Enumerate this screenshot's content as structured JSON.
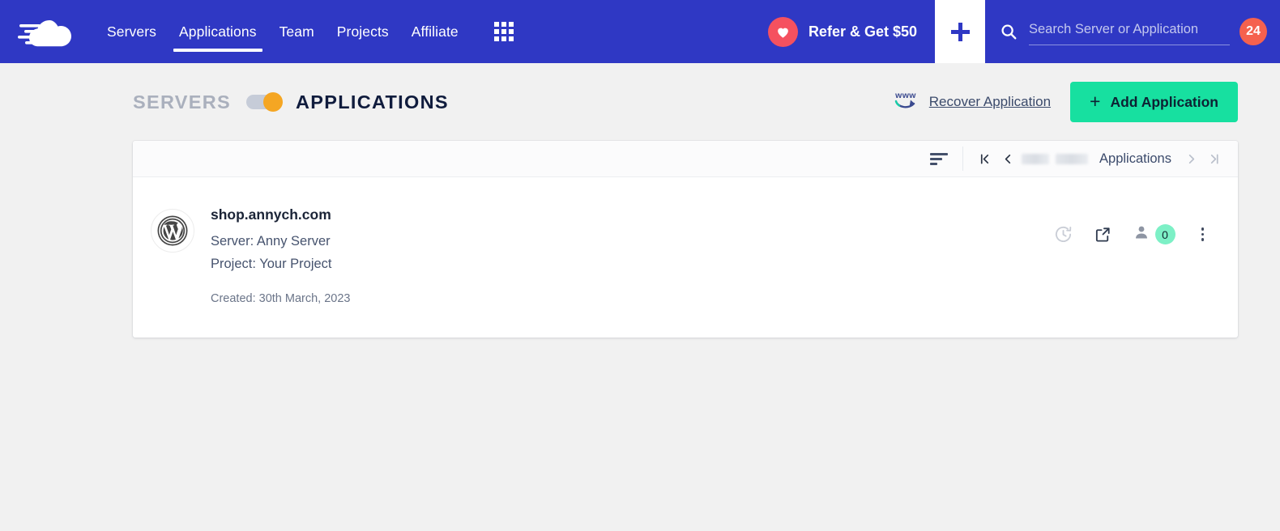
{
  "navbar": {
    "logo_name": "cloudways-logo",
    "links": [
      {
        "label": "Servers",
        "active": false
      },
      {
        "label": "Applications",
        "active": true
      },
      {
        "label": "Team",
        "active": false
      },
      {
        "label": "Projects",
        "active": false
      },
      {
        "label": "Affiliate",
        "active": false
      }
    ],
    "grid_icon": "apps-grid-icon",
    "refer": {
      "label": "Refer & Get $50",
      "icon": "heart-icon"
    },
    "add_button_icon": "plus-icon",
    "search": {
      "icon": "search-icon",
      "placeholder": "Search Server or Application",
      "value": ""
    },
    "notifications": {
      "count": "24"
    },
    "colors": {
      "background": "#2f38c4",
      "heart": "#f5515f",
      "badge": "#f5614e"
    }
  },
  "page_header": {
    "toggle": {
      "left_label": "SERVERS",
      "right_label": "APPLICATIONS",
      "state": "applications",
      "knob_color": "#f5a623",
      "track_color": "#c6ccd8"
    },
    "recover": {
      "icon": "www-recover-icon",
      "label": "Recover Application"
    },
    "add_application": {
      "plus": "+",
      "label": "Add Application",
      "color": "#17e0a0"
    }
  },
  "card": {
    "toolbar": {
      "sort_icon": "sort-icon",
      "pager": {
        "first_icon": "page-first-icon",
        "prev_icon": "page-prev-icon",
        "redacted_1": "",
        "redacted_2": "",
        "label": "Applications",
        "next_icon": "page-next-icon",
        "last_icon": "page-last-icon"
      }
    },
    "applications": [
      {
        "platform_icon": "wordpress-icon",
        "title": "shop.annych.com",
        "server": "Server: Anny Server",
        "project": "Project: Your Project",
        "created": "Created: 30th March, 2023",
        "actions": {
          "restore_icon": "restore-clock-icon",
          "launch_icon": "external-link-icon",
          "users_icon": "user-icon",
          "users_count": "0",
          "menu_icon": "kebab-menu-icon"
        }
      }
    ]
  }
}
